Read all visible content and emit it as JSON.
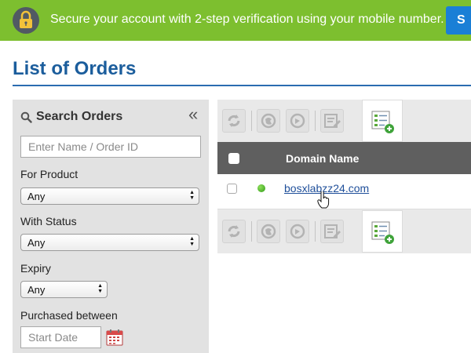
{
  "banner": {
    "message": "Secure your account with 2-step verification using your mobile number.",
    "button_label": "S",
    "bg_color": "#7dbf2f",
    "icon": "lock-icon"
  },
  "page": {
    "title": "List of Orders"
  },
  "search": {
    "title": "Search Orders",
    "collapse_label": "«",
    "name_placeholder": "Enter Name / Order ID",
    "product_label": "For Product",
    "product_value": "Any",
    "status_label": "With Status",
    "status_value": "Any",
    "expiry_label": "Expiry",
    "expiry_value": "Any",
    "purchased_label": "Purchased between",
    "start_date_placeholder": "Start Date"
  },
  "toolbar": {
    "icons": [
      "refresh-icon",
      "suspend-icon",
      "unsuspend-icon",
      "edit-icon",
      "add-order-icon"
    ]
  },
  "table": {
    "columns": [
      "Domain Name"
    ],
    "rows": [
      {
        "domain": "bosxlabzz24.com",
        "status_color": "#3aa81e"
      }
    ]
  }
}
